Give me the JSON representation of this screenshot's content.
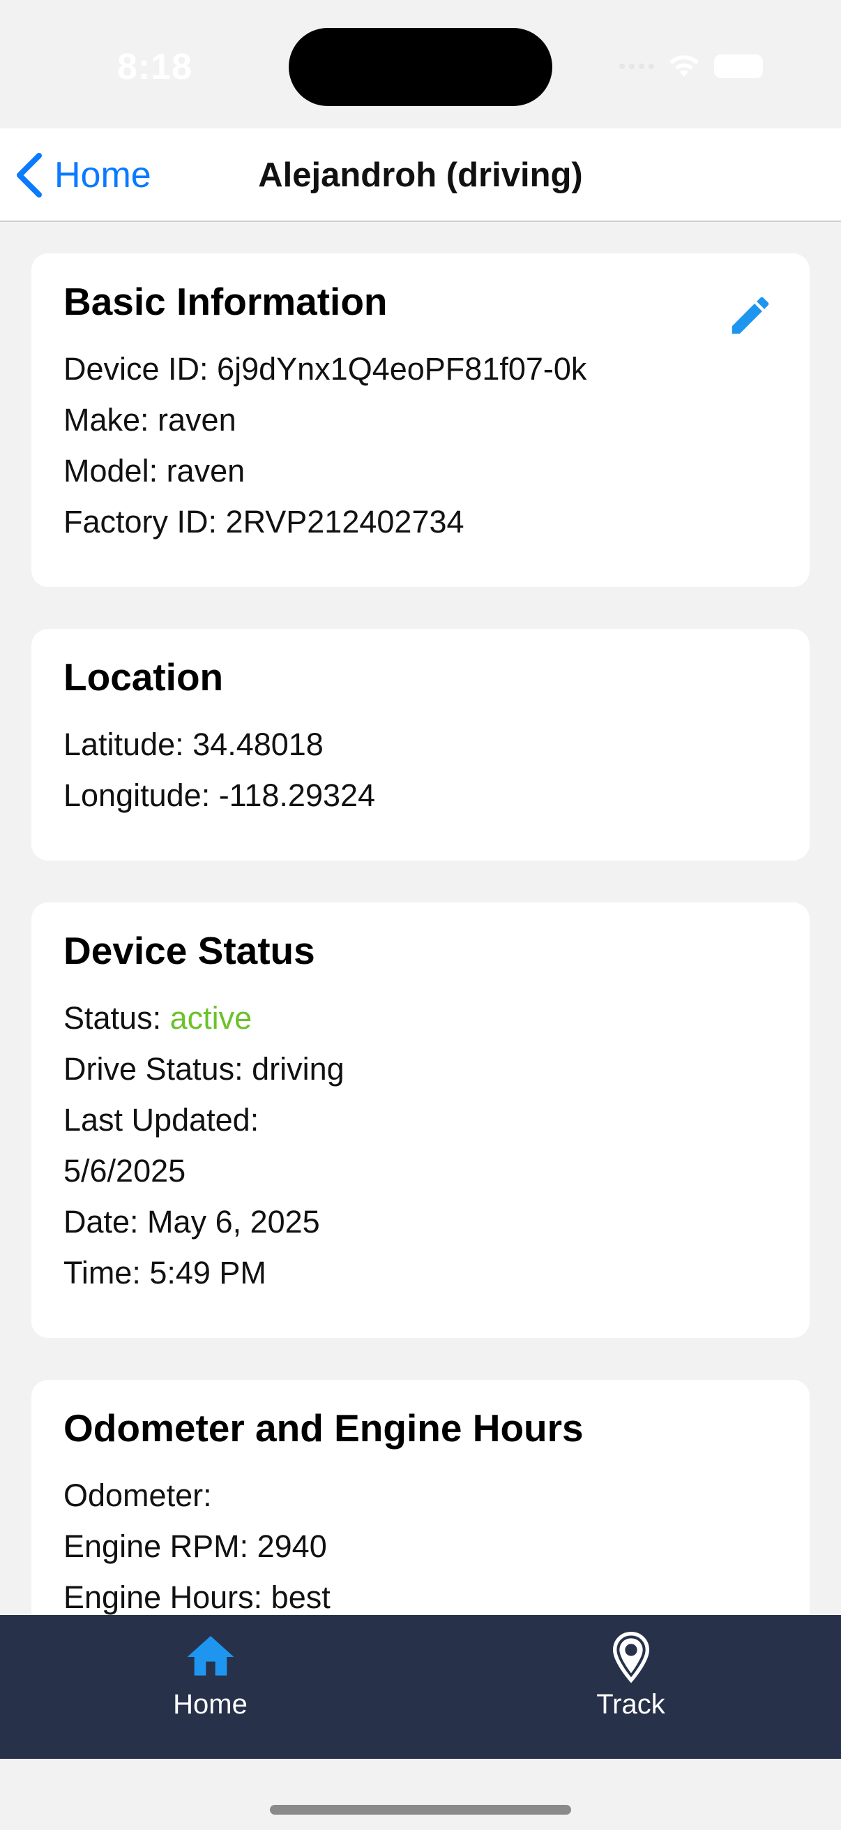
{
  "status_bar": {
    "time": "8:18"
  },
  "nav": {
    "back_label": "Home",
    "title": "Alejandroh (driving)"
  },
  "basic_info": {
    "title": "Basic Information",
    "device_id": "Device ID: 6j9dYnx1Q4eoPF81f07-0k",
    "make": "Make: raven",
    "model": "Model: raven",
    "factory_id": "Factory ID: 2RVP212402734"
  },
  "location": {
    "title": "Location",
    "latitude": "Latitude: 34.48018",
    "longitude": "Longitude: -118.29324"
  },
  "device_status": {
    "title": "Device Status",
    "status_label": "Status: ",
    "status_value": "active",
    "drive_status": "Drive Status: driving",
    "last_updated_label": "Last Updated:",
    "last_updated_value": "5/6/2025",
    "date": "Date: May 6, 2025",
    "time": "Time: 5:49 PM"
  },
  "odometer": {
    "title": "Odometer and Engine Hours",
    "odometer": "Odometer:",
    "engine_rpm": "Engine RPM: 2940",
    "engine_hours": "Engine Hours: best"
  },
  "tabs": [
    {
      "label": "Home",
      "icon": "home-icon"
    },
    {
      "label": "Track",
      "icon": "location-pin-icon"
    }
  ],
  "colors": {
    "accent": "#0a7aff",
    "icon_blue": "#1e96f0",
    "status_active": "#6cc22a",
    "tab_bar_bg": "#27314a"
  }
}
